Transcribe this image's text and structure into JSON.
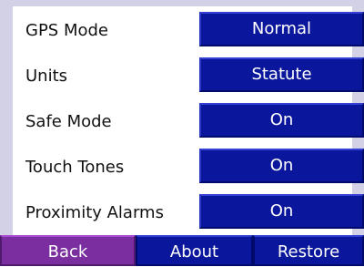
{
  "settings": [
    {
      "label": "GPS Mode",
      "value": "Normal"
    },
    {
      "label": "Units",
      "value": "Statute"
    },
    {
      "label": "Safe Mode",
      "value": "On"
    },
    {
      "label": "Touch Tones",
      "value": "On"
    },
    {
      "label": "Proximity Alarms",
      "value": "On"
    }
  ],
  "footer": {
    "back_label": "Back",
    "about_label": "About",
    "restore_label": "Restore"
  },
  "colors": {
    "background": "#d3d1e6",
    "value_button": "#0a169c",
    "back_button": "#7a2ea0"
  }
}
